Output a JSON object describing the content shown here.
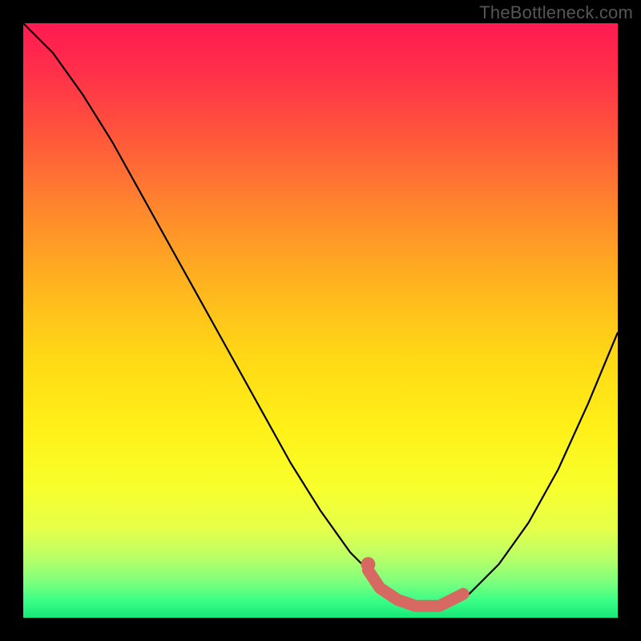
{
  "watermark": "TheBottleneck.com",
  "colors": {
    "background": "#000000",
    "curve": "#000000",
    "accent": "#d66a63"
  },
  "chart_data": {
    "type": "line",
    "title": "",
    "xlabel": "",
    "ylabel": "",
    "xlim": [
      0,
      100
    ],
    "ylim": [
      0,
      100
    ],
    "grid": false,
    "legend": false,
    "series": [
      {
        "name": "bottleneck-curve",
        "x": [
          0,
          5,
          10,
          15,
          20,
          25,
          30,
          35,
          40,
          45,
          50,
          55,
          60,
          63,
          66,
          70,
          75,
          80,
          85,
          90,
          95,
          100
        ],
        "values": [
          100,
          95,
          88,
          80,
          71,
          62,
          53,
          44,
          35,
          26,
          18,
          11,
          6,
          3,
          2,
          2,
          4,
          9,
          16,
          25,
          36,
          48
        ]
      }
    ],
    "annotations": [
      {
        "name": "accent-valley",
        "type": "thick-segment",
        "x": [
          58,
          60,
          63,
          66,
          70,
          74
        ],
        "values": [
          8,
          5,
          3,
          2,
          2,
          4
        ]
      },
      {
        "name": "accent-dot",
        "type": "dot",
        "x": 58,
        "value": 9
      }
    ],
    "background_gradient": {
      "top": "#ff1a52",
      "upper_mid": "#ffb41f",
      "mid": "#fff018",
      "lower_mid": "#b8ff68",
      "bottom": "#16e87a"
    }
  }
}
